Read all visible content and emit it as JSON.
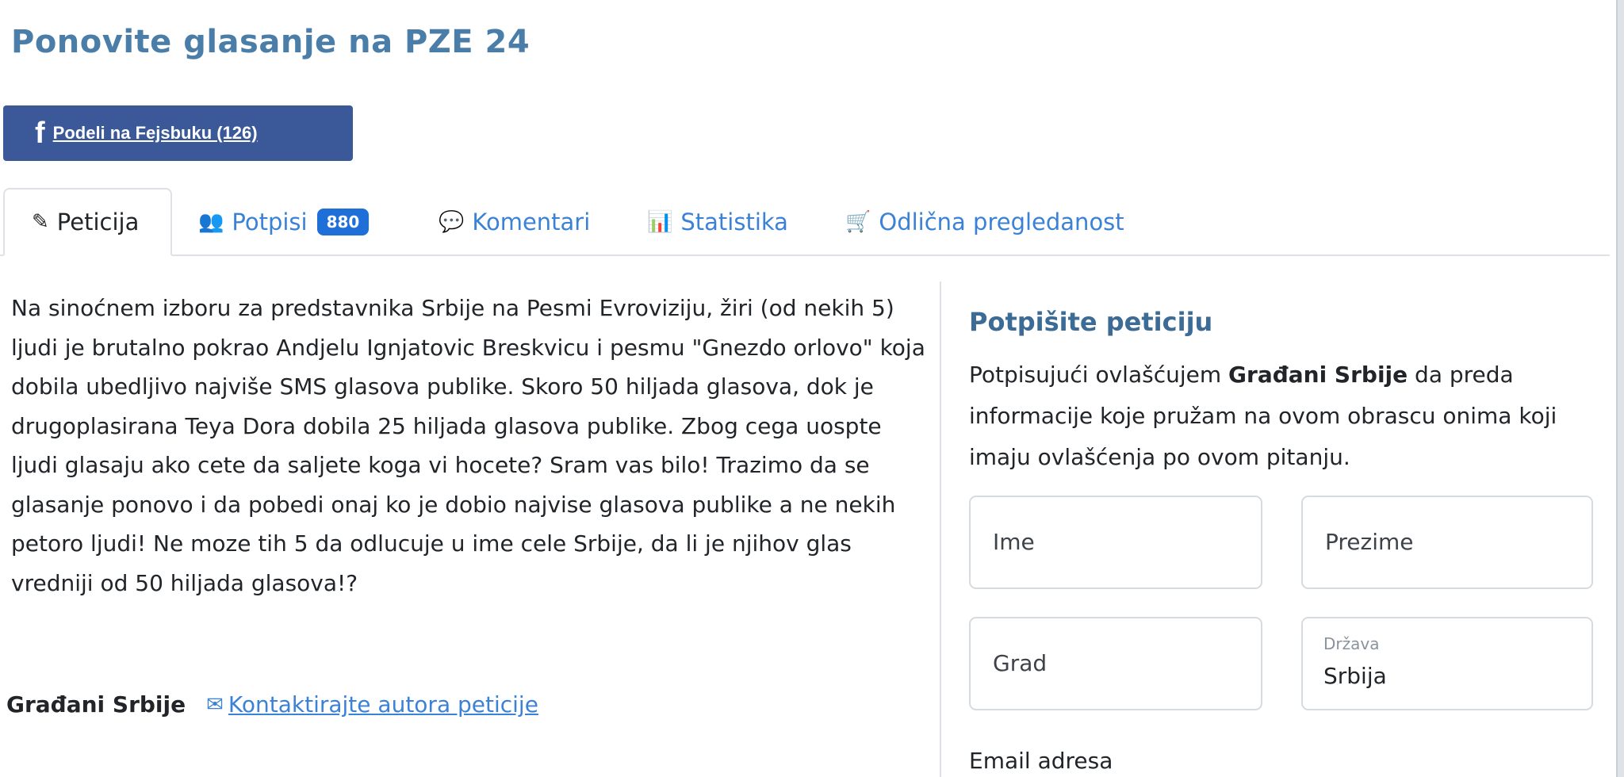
{
  "title": "Ponovite glasanje na PZE 24",
  "facebook_button": {
    "icon": "f",
    "label": "Podeli na Fejsbuku (126)"
  },
  "tabs": [
    {
      "icon": "✎",
      "label": "Peticija"
    },
    {
      "icon": "👥",
      "label": "Potpisi",
      "badge": "880"
    },
    {
      "icon": "💬",
      "label": "Komentari"
    },
    {
      "icon": "📊",
      "label": "Statistika"
    },
    {
      "icon": "🛒",
      "label": "Odlična pregledanost"
    }
  ],
  "petition_text": "Na sinoćnem izboru za predstavnika Srbije na Pesmi Evroviziju, žiri (od nekih 5) ljudi je brutalno pokrao Andjelu Ignjatovic Breskvicu i pesmu \"Gnezdo orlovo\" koja dobila ubedljivo najviše SMS glasova publike. Skoro 50 hiljada glasova, dok je drugoplasirana Teya Dora dobila 25 hiljada glasova publike. Zbog cega uospte ljudi glasaju ako cete da saljete koga vi hocete? Sram vas bilo! Trazimo da se glasanje ponovo i da pobedi onaj ko je dobio najvise glasova publike a ne nekih petoro ljudi! Ne moze tih 5 da odlucuje u ime cele Srbije, da li je njihov glas vredniji od 50 hiljada glasova!?",
  "author": {
    "name": "Građani Srbije",
    "contact_label": "Kontaktirajte autora peticije"
  },
  "sign_form": {
    "title": "Potpišite peticiju",
    "description_prefix": "Potpisujući ovlašćujem ",
    "description_org": "Građani Srbije",
    "description_suffix": " da preda informacije koje pružam na ovom obrascu onima koji imaju ovlašćenja po ovom pitanju.",
    "first_name_placeholder": "Ime",
    "last_name_placeholder": "Prezime",
    "city_placeholder": "Grad",
    "country_label": "Država",
    "country_value": "Srbija",
    "email_label": "Email adresa"
  },
  "colors": {
    "title": "#4a7ea8",
    "facebook": "#3b5998",
    "link": "#3b82d6",
    "badge": "#1f6fd9"
  }
}
